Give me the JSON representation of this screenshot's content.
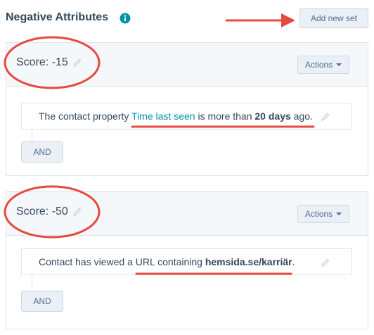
{
  "header": {
    "title": "Negative Attributes",
    "info_icon": "info-icon",
    "add_button_label": "Add new set"
  },
  "sets": [
    {
      "score_label": "Score: -15",
      "actions_label": "Actions",
      "rule": {
        "prefix": "The contact property ",
        "property": "Time last seen",
        "middle": " is more than ",
        "value": "20 days",
        "suffix": " ago."
      },
      "and_label": "AND"
    },
    {
      "score_label": "Score: -50",
      "actions_label": "Actions",
      "rule": {
        "prefix": "Contact has viewed a ",
        "property": "URL containing ",
        "value": "hemsida.se/karriär",
        "suffix": "."
      },
      "and_label": "AND"
    }
  ],
  "colors": {
    "annotation": "#e8493f",
    "link": "#0091ae",
    "info": "#0091ae"
  }
}
